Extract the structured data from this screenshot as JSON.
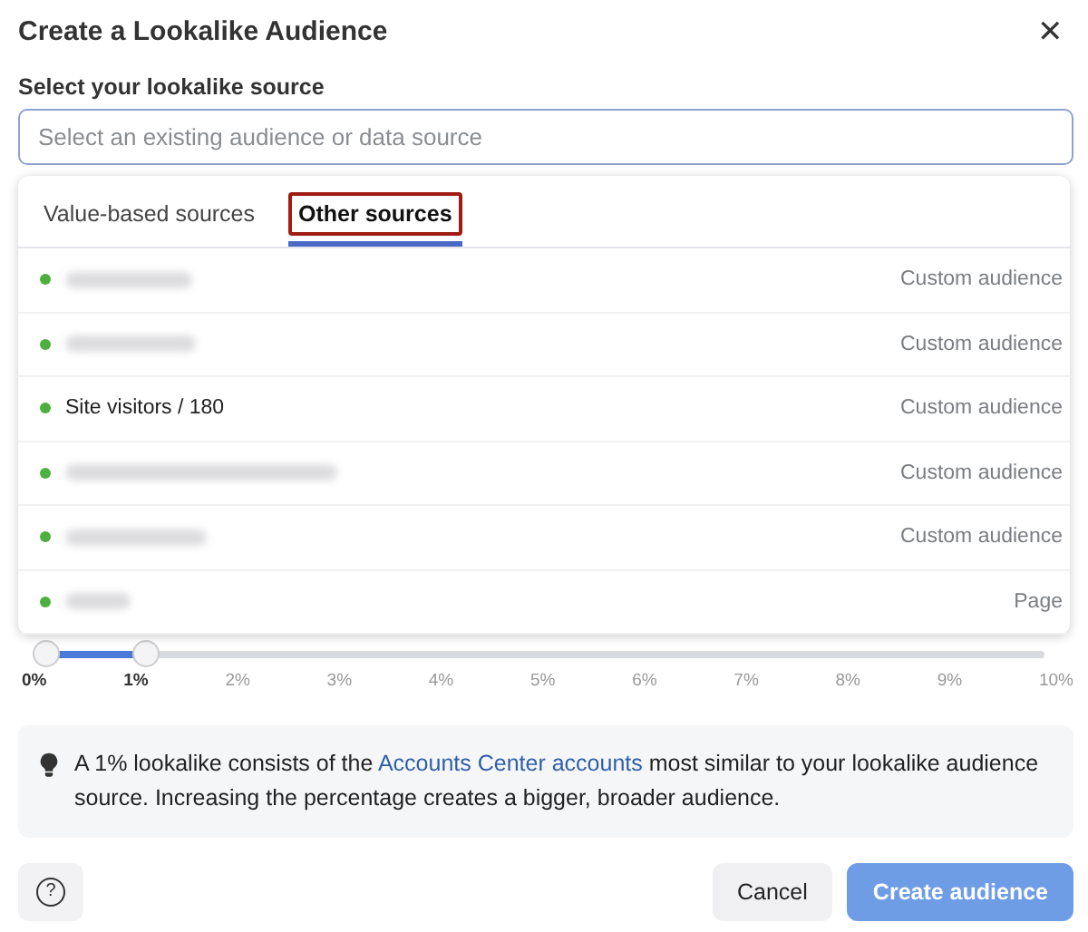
{
  "dialog": {
    "title": "Create a Lookalike Audience",
    "close": "✕"
  },
  "source": {
    "label": "Select your lookalike source",
    "placeholder": "Select an existing audience or data source"
  },
  "dropdown": {
    "tabs": [
      {
        "label": "Value-based sources",
        "selected": false,
        "highlighted": false
      },
      {
        "label": "Other sources",
        "selected": true,
        "highlighted": true
      }
    ],
    "items": [
      {
        "kind": "redacted",
        "type": "Custom audience",
        "color": "#4caf3f"
      },
      {
        "kind": "redacted",
        "type": "Custom audience",
        "color": "#4caf3f"
      },
      {
        "kind": "text",
        "name": "Site visitors / 180",
        "type": "Custom audience",
        "color": "#4caf3f"
      },
      {
        "kind": "redacted",
        "type": "Custom audience",
        "color": "#4caf3f"
      },
      {
        "kind": "redacted",
        "type": "Custom audience",
        "color": "#4caf3f"
      },
      {
        "kind": "redacted",
        "type": "Page",
        "color": "#4caf3f"
      }
    ]
  },
  "slider": {
    "level": 0.1,
    "ticks": [
      {
        "label": "0%",
        "active": true
      },
      {
        "label": "1%",
        "active": true
      },
      {
        "label": "2%",
        "active": false
      },
      {
        "label": "3%",
        "active": false
      },
      {
        "label": "4%",
        "active": false
      },
      {
        "label": "5%",
        "active": false
      },
      {
        "label": "6%",
        "active": false
      },
      {
        "label": "7%",
        "active": false
      },
      {
        "label": "8%",
        "active": false
      },
      {
        "label": "9%",
        "active": false
      },
      {
        "label": "10%",
        "active": false
      }
    ]
  },
  "info": {
    "before": "A 1% lookalike consists of the ",
    "link": "Accounts Center accounts",
    "after": " most similar to your lookalike audience source. Increasing the percentage creates a bigger, broader audience."
  },
  "footer": {
    "help": "?",
    "buttons": [
      {
        "label": "Cancel",
        "kind": "secondary",
        "disabled": false
      },
      {
        "label": "Create audience",
        "kind": "primary",
        "disabled": true
      }
    ]
  }
}
